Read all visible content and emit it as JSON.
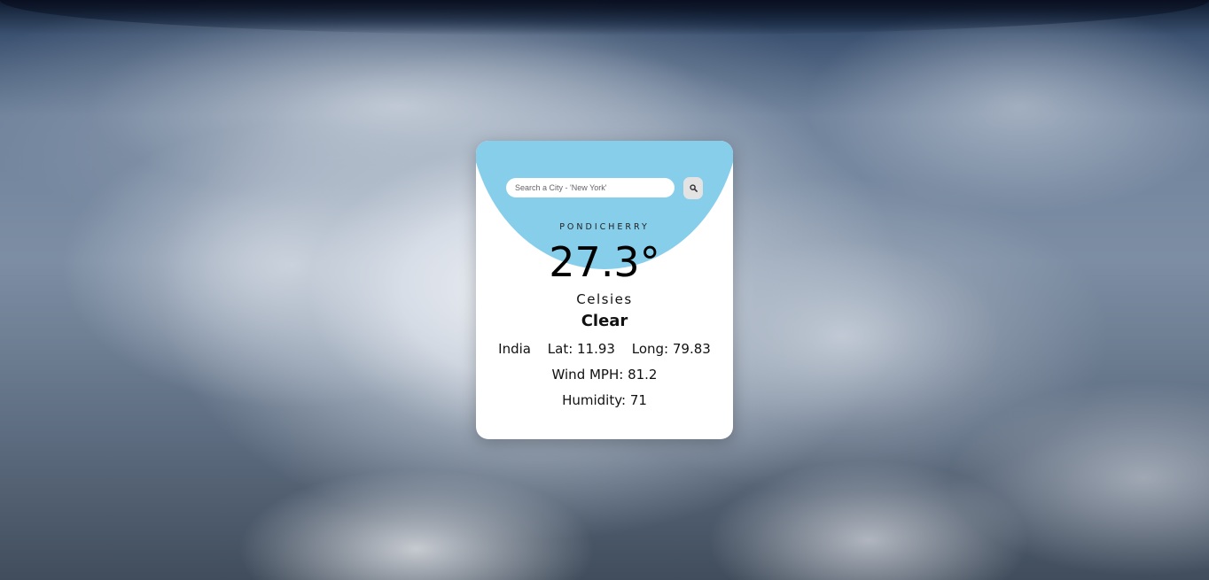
{
  "search": {
    "placeholder": "Search a City - 'New York'",
    "value": ""
  },
  "weather": {
    "city": "PONDICHERRY",
    "temperature": "27.3°",
    "unit": "Celsies",
    "condition": "Clear",
    "country": "India",
    "lat": "Lat: 11.93",
    "long": "Long: 79.83",
    "wind": "Wind MPH: 81.2",
    "humidity": "Humidity: 71"
  },
  "colors": {
    "accent": "#87ceeb",
    "card": "#ffffff",
    "search_button": "#e3e3e3"
  },
  "icons": {
    "search_button": "search-icon"
  }
}
